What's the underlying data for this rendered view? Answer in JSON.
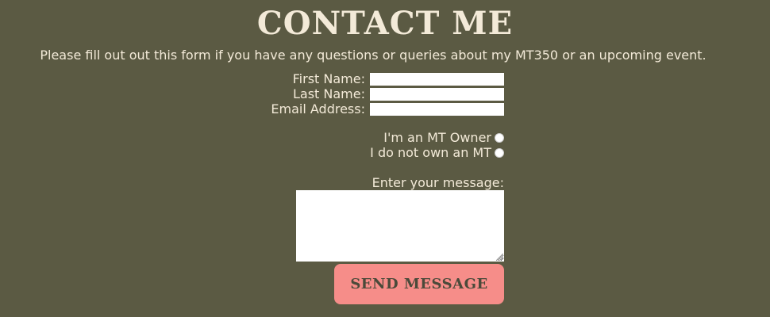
{
  "page": {
    "title": "Contact Me",
    "intro": "Please fill out out this form if you have any questions or queries about my MT350 or an upcoming event."
  },
  "form": {
    "first_name_label": "First Name:",
    "first_name_value": "",
    "last_name_label": "Last Name:",
    "last_name_value": "",
    "email_label": "Email Address:",
    "email_value": "",
    "owner_radio_label": "I'm an MT Owner",
    "non_owner_radio_label": "I do not own an MT",
    "message_label": "Enter your message:",
    "message_value": "",
    "send_label": "Send Message"
  },
  "colors": {
    "background": "#5b5a43",
    "text": "#f3ead8",
    "send_button": "#f68d89",
    "send_button_text": "#4a4a3a"
  }
}
